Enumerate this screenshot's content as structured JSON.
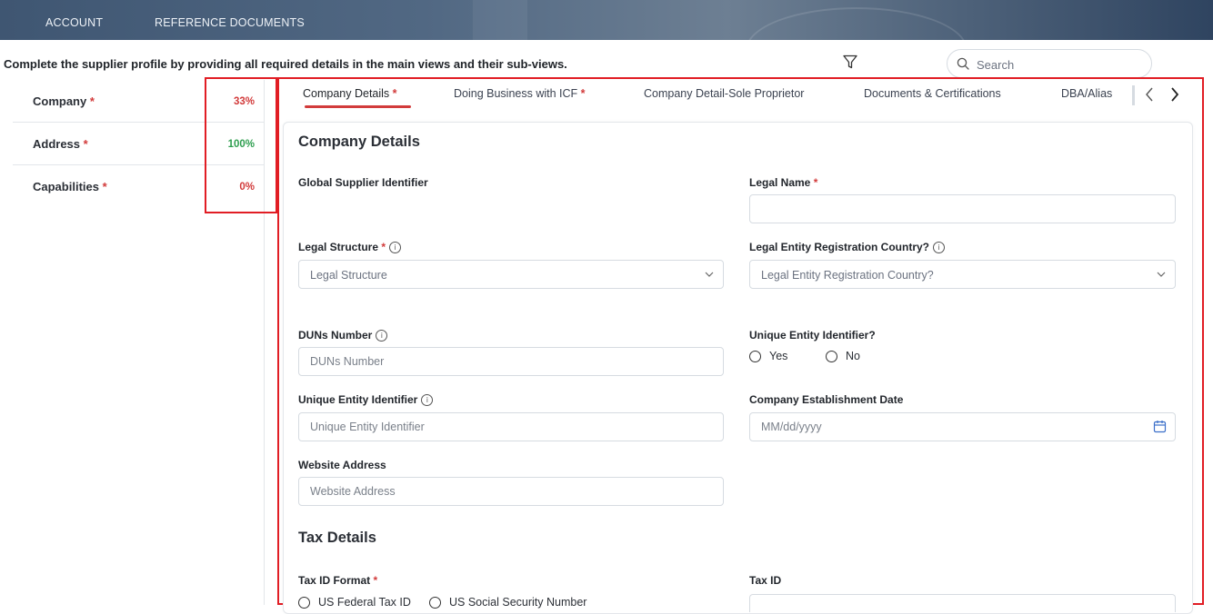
{
  "topnav": {
    "account": "ACCOUNT",
    "reference_documents": "REFERENCE DOCUMENTS"
  },
  "instruction": "Complete the supplier profile by providing all required details in the main views and their sub-views.",
  "search": {
    "placeholder": "Search"
  },
  "sidebar": {
    "items": [
      {
        "label": "Company",
        "required": "*",
        "percent": "33%",
        "color": "#d23b3b"
      },
      {
        "label": "Address",
        "required": "*",
        "percent": "100%",
        "color": "#2e9e4f"
      },
      {
        "label": "Capabilities",
        "required": "*",
        "percent": "0%",
        "color": "#d23b3b"
      }
    ]
  },
  "tabs": [
    {
      "label": "Company Details",
      "required": "*",
      "active": true
    },
    {
      "label": "Doing Business with ICF",
      "required": "*"
    },
    {
      "label": "Company Detail-Sole Proprietor"
    },
    {
      "label": "Documents & Certifications"
    },
    {
      "label": "DBA/Alias"
    }
  ],
  "company_details": {
    "title": "Company Details",
    "global_supplier_identifier": {
      "label": "Global Supplier Identifier"
    },
    "legal_name": {
      "label": "Legal Name",
      "required": "*",
      "value": ""
    },
    "legal_structure": {
      "label": "Legal Structure",
      "required": "*",
      "placeholder": "Legal Structure"
    },
    "legal_entity_country": {
      "label": "Legal Entity Registration Country?",
      "placeholder": "Legal Entity Registration Country?"
    },
    "duns": {
      "label": "DUNs Number",
      "placeholder": "DUNs Number"
    },
    "unique_entity_q": {
      "label": "Unique Entity Identifier?",
      "options": [
        "Yes",
        "No"
      ]
    },
    "unique_entity": {
      "label": "Unique Entity Identifier",
      "placeholder": "Unique Entity Identifier"
    },
    "establishment_date": {
      "label": "Company Establishment Date",
      "placeholder": "MM/dd/yyyy"
    },
    "website": {
      "label": "Website Address",
      "placeholder": "Website Address"
    }
  },
  "tax_details": {
    "title": "Tax Details",
    "format": {
      "label": "Tax ID Format",
      "required": "*",
      "options": [
        "US Federal Tax ID",
        "US Social Security Number"
      ]
    },
    "tax_id": {
      "label": "Tax ID"
    }
  },
  "colors": {
    "accent_red": "#d23b3b",
    "highlight_box": "#e11d24",
    "success_green": "#2e9e4f"
  },
  "icons": [
    "filter-icon",
    "search-icon",
    "info-icon",
    "chevron-down-icon",
    "calendar-icon",
    "chevron-left-icon",
    "chevron-right-icon"
  ]
}
